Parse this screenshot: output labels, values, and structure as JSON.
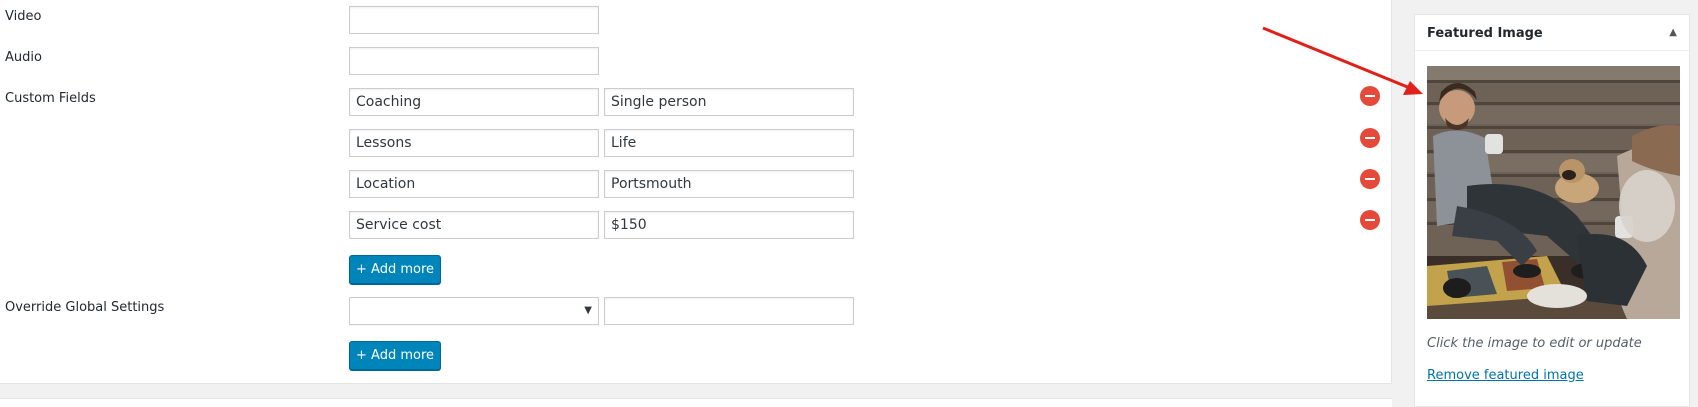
{
  "fields": {
    "video": {
      "label": "Video",
      "value": ""
    },
    "audio": {
      "label": "Audio",
      "value": ""
    },
    "custom_fields": {
      "label": "Custom Fields",
      "rows": [
        {
          "key": "Coaching",
          "value": "Single person"
        },
        {
          "key": "Lessons",
          "value": "Life"
        },
        {
          "key": "Location",
          "value": "Portsmouth"
        },
        {
          "key": "Service cost",
          "value": "$150"
        }
      ],
      "add_label": "+ Add more"
    },
    "override": {
      "label": "Override Global Settings",
      "select_value": "",
      "text_value": "",
      "add_label": "+ Add more"
    }
  },
  "sidebar": {
    "title": "Featured Image",
    "toggle_icon": "triangle-up-icon",
    "hint": "Click the image to edit or update",
    "remove_link": "Remove featured image"
  },
  "colors": {
    "primary_button": "#0085ba",
    "remove_button": "#e5493a",
    "annotation_arrow": "#e0201b",
    "link": "#0073aa"
  }
}
